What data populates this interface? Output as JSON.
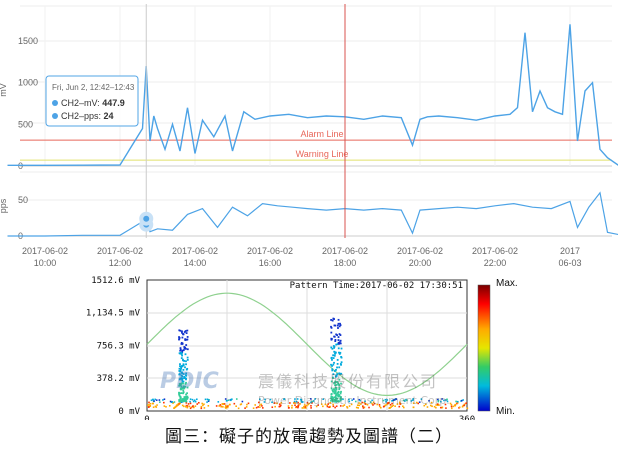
{
  "trend": {
    "y_unit_top": "mV",
    "y_unit_bottom": "pps",
    "mv_ticks": [
      0,
      500,
      1000,
      1500
    ],
    "pps_ticks": [
      0,
      50
    ],
    "x_ticks": [
      {
        "date": "2017-06-02",
        "time": "10:00",
        "hour": 10
      },
      {
        "date": "2017-06-02",
        "time": "12:00",
        "hour": 12
      },
      {
        "date": "2017-06-02",
        "time": "14:00",
        "hour": 14
      },
      {
        "date": "2017-06-02",
        "time": "16:00",
        "hour": 16
      },
      {
        "date": "2017-06-02",
        "time": "18:00",
        "hour": 18
      },
      {
        "date": "2017-06-02",
        "time": "20:00",
        "hour": 20
      },
      {
        "date": "2017-06-02",
        "time": "22:00",
        "hour": 22
      },
      {
        "date": "2017",
        "time": "06-03",
        "hour": 24
      }
    ],
    "alarm_label": "Alarm Line",
    "warning_label": "Warning Line",
    "alarm_value": 310,
    "warning_value": 70,
    "cursor_hour": 18.0,
    "hover_hour": 12.7,
    "tooltip": {
      "title": "Fri, Jun 2, 12:42–12:43",
      "mv_label": "CH2–mV: ",
      "mv_value": "447.9",
      "pps_label": "CH2–pps: ",
      "pps_value": "24"
    },
    "colors": {
      "series": "#4da3e6",
      "alarm": "#e8675a",
      "warning": "#e0e06a",
      "cursor": "#d9534f"
    }
  },
  "chart_data": [
    {
      "type": "line",
      "series": [
        {
          "name": "CH2–mV",
          "x_hours": [
            9.0,
            10.0,
            11.0,
            12.0,
            12.6,
            12.7,
            12.8,
            12.9,
            13.0,
            13.2,
            13.4,
            13.6,
            13.8,
            14.0,
            14.2,
            14.5,
            14.8,
            15.0,
            15.3,
            15.6,
            16.0,
            16.5,
            17.0,
            17.5,
            18.0,
            18.5,
            19.0,
            19.5,
            19.8,
            20.0,
            20.2,
            20.5,
            21.0,
            21.5,
            22.0,
            22.4,
            22.6,
            22.8,
            23.0,
            23.2,
            23.4,
            23.6,
            23.8,
            24.0,
            24.2,
            24.4,
            24.6,
            24.8,
            25.0,
            25.3
          ],
          "y": [
            8,
            8,
            10,
            12,
            450,
            1200,
            300,
            600,
            450,
            200,
            500,
            180,
            700,
            150,
            550,
            350,
            600,
            180,
            650,
            560,
            600,
            620,
            580,
            600,
            590,
            560,
            600,
            580,
            250,
            560,
            590,
            600,
            580,
            550,
            600,
            620,
            700,
            1600,
            650,
            900,
            700,
            650,
            620,
            1700,
            300,
            900,
            1000,
            200,
            100,
            5
          ]
        }
      ],
      "xlabel": "",
      "ylabel": "mV",
      "ylim": [
        0,
        1750
      ]
    },
    {
      "type": "line",
      "series": [
        {
          "name": "CH2–pps",
          "x_hours": [
            9.0,
            10.0,
            11.0,
            12.0,
            12.6,
            12.7,
            12.8,
            13.0,
            13.4,
            13.8,
            14.2,
            14.6,
            15.0,
            15.4,
            15.8,
            16.2,
            16.6,
            17.0,
            17.5,
            18.0,
            18.5,
            19.0,
            19.5,
            19.8,
            20.0,
            20.5,
            21.0,
            21.5,
            22.0,
            22.5,
            23.0,
            23.5,
            24.0,
            24.2,
            24.5,
            24.8,
            25.0,
            25.3
          ],
          "y": [
            0,
            0,
            1,
            1,
            20,
            24,
            6,
            10,
            8,
            30,
            38,
            12,
            40,
            28,
            45,
            42,
            40,
            38,
            36,
            38,
            36,
            38,
            36,
            4,
            36,
            38,
            40,
            38,
            42,
            45,
            40,
            38,
            48,
            12,
            40,
            60,
            5,
            2
          ]
        }
      ],
      "ylabel": "pps",
      "ylim": [
        0,
        75
      ]
    },
    {
      "type": "scatter",
      "title": "Pattern Time:2017-06-02 17:30:51",
      "xlabel": "",
      "ylabel": "mV",
      "x_tick_labels": [
        "0",
        "360"
      ],
      "y_tick_labels": [
        "0 mV",
        "378.2 mV",
        "756.3 mV",
        "1,134.5 mV",
        "1512.6 mV"
      ],
      "y_ticks": [
        0,
        378.2,
        756.3,
        1134.5,
        1512.6
      ],
      "xlim": [
        0,
        360
      ],
      "ylim": [
        0,
        1512.6
      ],
      "colorbar_max_label": "Max.",
      "colorbar_min_label": "Min.",
      "clusters": [
        {
          "phase_center": 40,
          "phase_spread": 5,
          "max_mv": 950
        },
        {
          "phase_center": 212,
          "phase_spread": 6,
          "max_mv": 1080
        }
      ],
      "reference_sine_amplitude_mv": 590,
      "reference_sine_offset_mv": 770
    }
  ],
  "watermark": {
    "brand": "PDIC",
    "company_zh": "震儀科技股份有限公司",
    "company_en": "Power Diagnostic Instrument Corp."
  },
  "caption": "圖三：礙子的放電趨勢及圖譜（二）"
}
